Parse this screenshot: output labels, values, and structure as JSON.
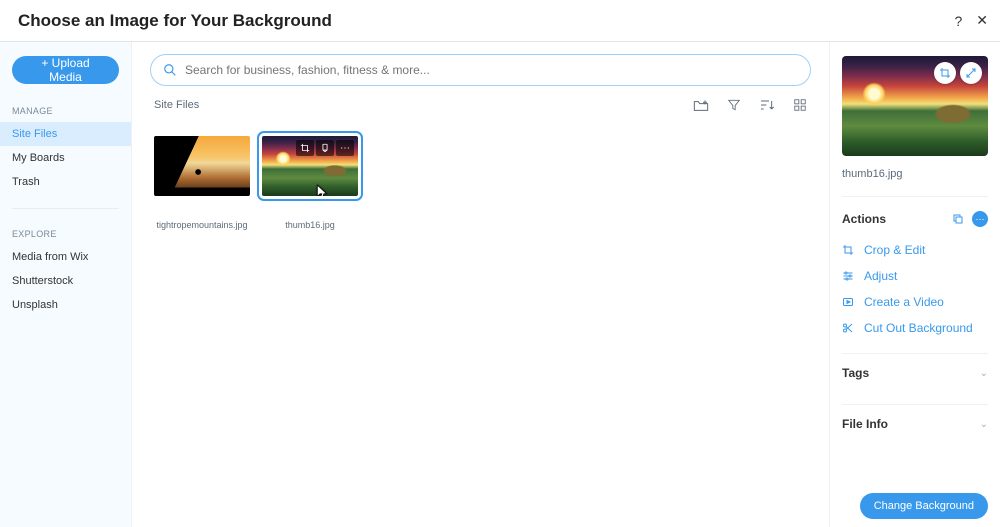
{
  "header": {
    "title": "Choose an Image for Your Background",
    "help": "?",
    "close": "✕"
  },
  "sidebar": {
    "upload_label": "+ Upload Media",
    "manage_label": "MANAGE",
    "explore_label": "EXPLORE",
    "manage_items": [
      {
        "label": "Site Files"
      },
      {
        "label": "My Boards"
      },
      {
        "label": "Trash"
      }
    ],
    "explore_items": [
      {
        "label": "Media from Wix"
      },
      {
        "label": "Shutterstock"
      },
      {
        "label": "Unsplash"
      }
    ]
  },
  "search": {
    "placeholder": "Search for business, fashion, fitness & more..."
  },
  "breadcrumb": {
    "label": "Site Files"
  },
  "toolbar_icons": {
    "new_folder": "new-folder-icon",
    "filter": "filter-icon",
    "sort": "sort-icon",
    "grid": "grid-view-icon"
  },
  "files": [
    {
      "name": "tightropemountains.jpg",
      "thumb_class": "tightrope",
      "selected": false
    },
    {
      "name": "thumb16.jpg",
      "thumb_class": "sunset",
      "selected": true
    }
  ],
  "detail": {
    "file_name": "thumb16.jpg",
    "actions_title": "Actions",
    "actions": {
      "crop": "Crop & Edit",
      "adjust": "Adjust",
      "video": "Create a Video",
      "cutout": "Cut Out Background"
    },
    "tags_title": "Tags",
    "fileinfo_title": "File Info"
  },
  "footer": {
    "change_bg": "Change Background"
  }
}
